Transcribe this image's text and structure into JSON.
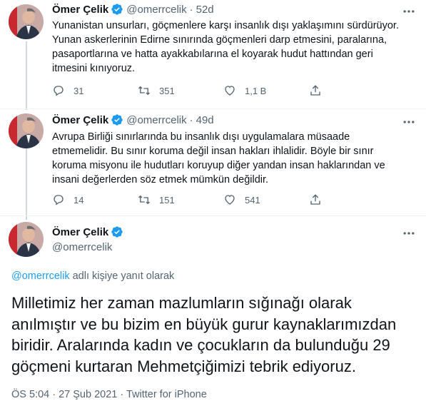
{
  "tweets": [
    {
      "name": "Ömer Çelik",
      "handle": "@omerrcelik",
      "time": "52d",
      "lines": [
        "Yunanistan unsurları, göçmenlere karşı insanlık dışı yaklaşımını sürdürüyor.",
        "Yunan askerlerinin Edirne sınırında göçmenleri darp etmesini, paralarına,",
        "pasaportlarına ve hatta ayakkabılarına el koyarak hudut hattından geri",
        "itmesini kınıyoruz."
      ],
      "replies": "31",
      "retweets": "351",
      "likes": "1,1 B"
    },
    {
      "name": "Ömer Çelik",
      "handle": "@omerrcelik",
      "time": "49d",
      "lines": [
        "Avrupa Birliği sınırlarında bu insanlık dışı uygulamalara müsaade",
        "etmemelidir. Bu sınır koruma değil insan hakları ihlalidir. Böyle bir sınır",
        "koruma misyonu ile hudutları koruyup diğer yandan insan haklarından ve",
        "insani değerlerden söz etmek mümkün değildir."
      ],
      "replies": "14",
      "retweets": "151",
      "likes": "541"
    }
  ],
  "main": {
    "name": "Ömer Çelik",
    "handle": "@omerrcelik",
    "reply_mention": "@omerrcelik",
    "reply_suffix": " adlı kişiye yanıt olarak",
    "lines": [
      "Milletimiz her zaman mazlumların sığınağı olarak",
      "anılmıştır ve bu bizim en büyük gurur kaynaklarımızdan",
      "biridir. Aralarında kadın ve çocukların da bulunduğu 29",
      "göçmeni kurtaran Mehmetçiğimizi tebrik ediyoruz."
    ],
    "meta": "ÖS 5:04 · 27 Şub 2021 · Twitter for iPhone"
  },
  "icons": {
    "reply": "reply-icon",
    "retweet": "retweet-icon",
    "like": "heart-icon",
    "share": "share-icon",
    "more": "more-icon",
    "verified": "verified-badge-icon"
  },
  "colors": {
    "accent": "#1d9bf0",
    "secondary_text": "#536471",
    "primary_text": "#0f1419"
  }
}
